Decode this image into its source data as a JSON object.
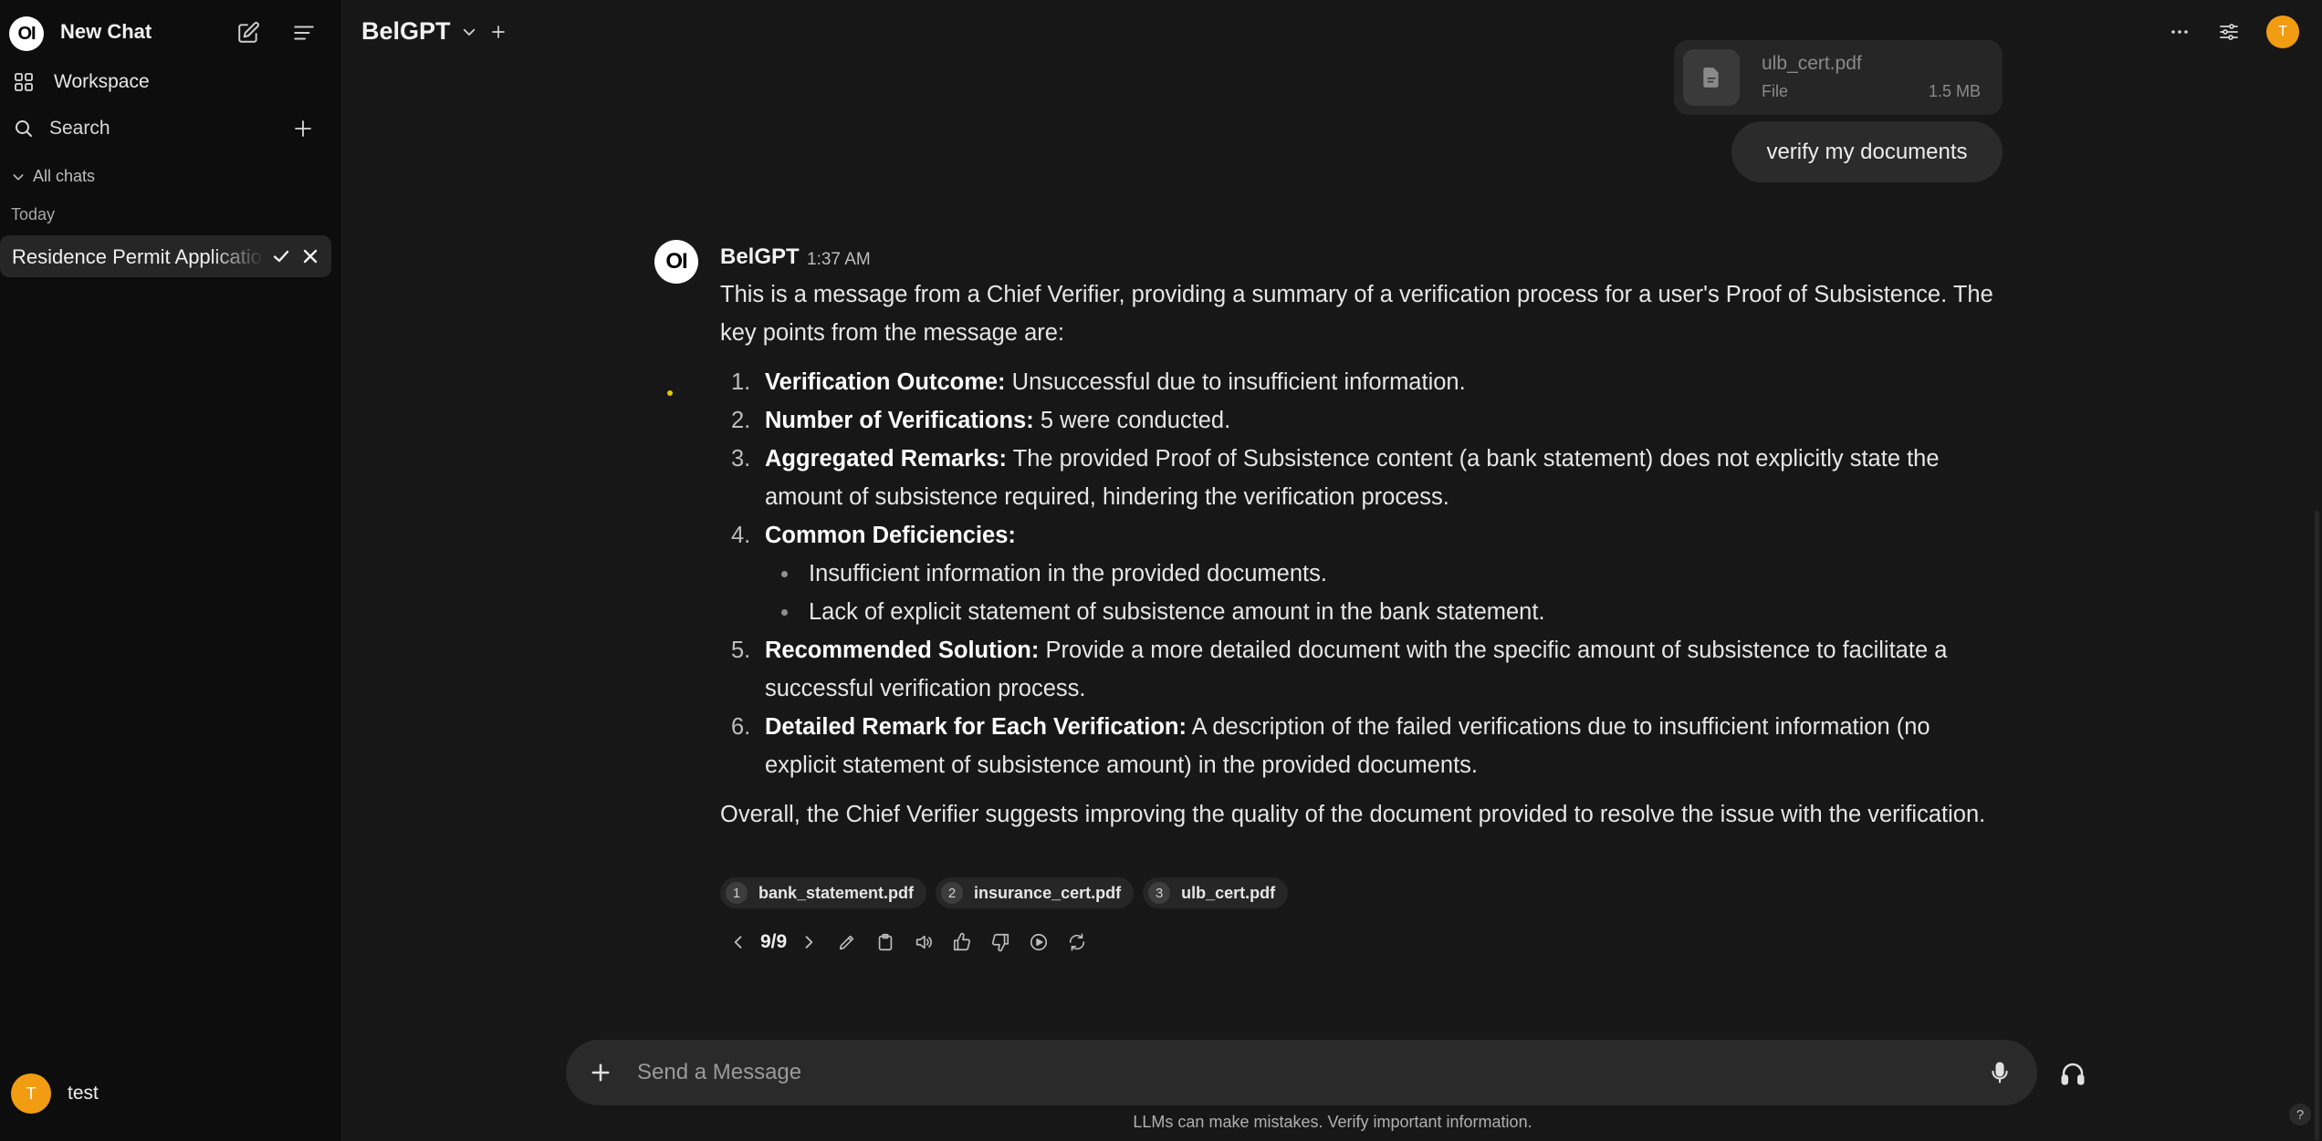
{
  "sidebar": {
    "logo_text": "OI",
    "new_chat_label": "New Chat",
    "workspace_label": "Workspace",
    "search_label": "Search",
    "all_chats_label": "All chats",
    "today_label": "Today",
    "chat_items": [
      {
        "title": "Residence Permit Application"
      }
    ],
    "user": {
      "initial": "T",
      "name": "test"
    }
  },
  "header": {
    "model_name": "BelGPT",
    "avatar_initial": "T"
  },
  "conversation": {
    "attachment": {
      "name": "ulb_cert.pdf",
      "type": "File",
      "size": "1.5 MB"
    },
    "user_message": "verify my documents",
    "assistant": {
      "avatar_text": "OI",
      "name": "BelGPT",
      "time": "1:37 AM",
      "intro": "This is a message from a Chief Verifier, providing a summary of a verification process for a user's Proof of Subsistence. The key points from the message are:",
      "points": [
        {
          "num": "1.",
          "label": "Verification Outcome:",
          "text": " Unsuccessful due to insufficient information."
        },
        {
          "num": "2.",
          "label": "Number of Verifications:",
          "text": " 5 were conducted."
        },
        {
          "num": "3.",
          "label": "Aggregated Remarks:",
          "text": " The provided Proof of Subsistence content (a bank statement) does not explicitly state the amount of subsistence required, hindering the verification process."
        },
        {
          "num": "4.",
          "label": "Common Deficiencies:",
          "text": ""
        },
        {
          "num": "5.",
          "label": "Recommended Solution:",
          "text": " Provide a more detailed document with the specific amount of subsistence to facilitate a successful verification process."
        },
        {
          "num": "6.",
          "label": "Detailed Remark for Each Verification:",
          "text": " A description of the failed verifications due to insufficient information (no explicit statement of subsistence amount) in the provided documents."
        }
      ],
      "deficiencies": [
        "Insufficient information in the provided documents.",
        "Lack of explicit statement of subsistence amount in the bank statement."
      ],
      "outro": "Overall, the Chief Verifier suggests improving the quality of the document provided to resolve the issue with the verification.",
      "citations": [
        {
          "n": "1",
          "file": "bank_statement.pdf"
        },
        {
          "n": "2",
          "file": "insurance_cert.pdf"
        },
        {
          "n": "3",
          "file": "ulb_cert.pdf"
        }
      ],
      "pager": "9/9"
    }
  },
  "composer": {
    "placeholder": "Send a Message",
    "disclaimer": "LLMs can make mistakes. Verify important information.",
    "help_label": "?"
  },
  "colors": {
    "background": "#171717",
    "sidebar": "#0d0d0d",
    "accent_avatar": "#f29c11"
  }
}
